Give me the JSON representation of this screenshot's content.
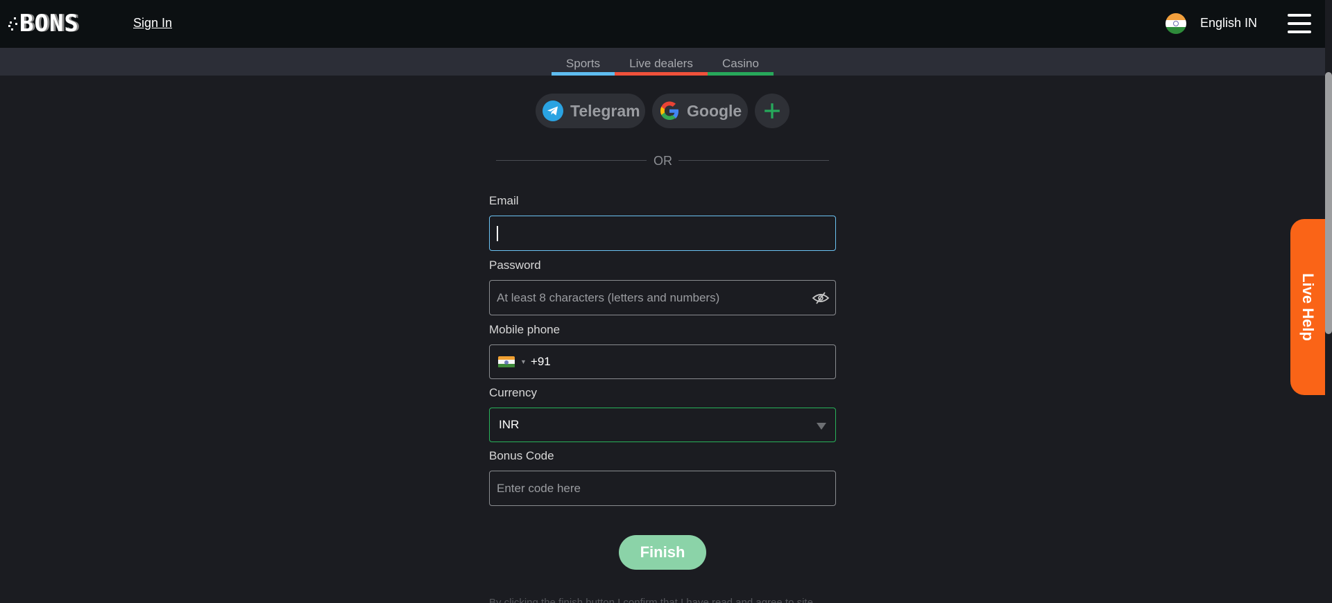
{
  "header": {
    "logo": "BONS",
    "sign_in": "Sign In",
    "language": "English IN",
    "language_flag": "india-flag-icon"
  },
  "categories": [
    {
      "label": "Sports",
      "color": "#5fbdf0"
    },
    {
      "label": "Live dealers",
      "color": "#f0513b"
    },
    {
      "label": "Casino",
      "color": "#27a85a"
    }
  ],
  "social": {
    "telegram": "Telegram",
    "google": "Google",
    "more": "+"
  },
  "divider": "OR",
  "form": {
    "email": {
      "label": "Email",
      "value": "",
      "placeholder": ""
    },
    "password": {
      "label": "Password",
      "value": "",
      "placeholder": "At least 8 characters (letters and numbers)"
    },
    "phone": {
      "label": "Mobile phone",
      "country": "India",
      "code": "+91"
    },
    "currency": {
      "label": "Currency",
      "value": "INR"
    },
    "bonus": {
      "label": "Bonus Code",
      "value": "",
      "placeholder": "Enter code here"
    },
    "submit": "Finish",
    "disclaimer": "By clicking the finish button I confirm that I have read and agree to site"
  },
  "live_help": "Live Help"
}
